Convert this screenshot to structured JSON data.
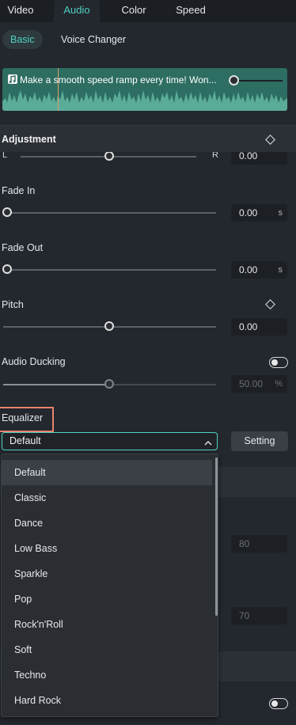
{
  "tabs": [
    "Video",
    "Audio",
    "Color",
    "Speed"
  ],
  "subtabs": [
    "Basic",
    "Voice Changer"
  ],
  "clip": {
    "title": "Make a smooth speed ramp every time!  Won..."
  },
  "adjustment": {
    "title": "Adjustment",
    "pan_left": "L",
    "pan_right": "R",
    "pan_value": "0.00"
  },
  "fade_in": {
    "label": "Fade In",
    "value": "0.00",
    "unit": "s"
  },
  "fade_out": {
    "label": "Fade Out",
    "value": "0.00",
    "unit": "s"
  },
  "pitch": {
    "label": "Pitch",
    "value": "0.00"
  },
  "audio_ducking": {
    "label": "Audio Ducking",
    "value": "50.00",
    "unit": "%"
  },
  "equalizer": {
    "label": "Equalizer",
    "selected": "Default",
    "setting_button": "Setting",
    "options": [
      "Default",
      "Classic",
      "Dance",
      "Low Bass",
      "Sparkle",
      "Pop",
      "Rock'n'Roll",
      "Soft",
      "Techno",
      "Hard Rock"
    ]
  },
  "hidden_values": [
    "80",
    "70"
  ],
  "colors": {
    "accent": "#4fd1c0",
    "clip": "#2d6d62",
    "highlight": "#e8836a",
    "background": "#23272e"
  }
}
